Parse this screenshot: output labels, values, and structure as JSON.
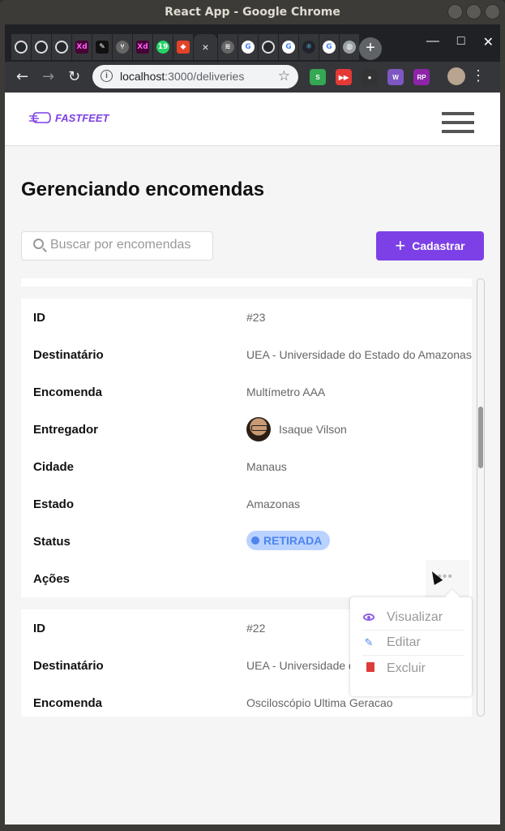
{
  "window": {
    "title": "React App - Google Chrome"
  },
  "browser": {
    "tabs": [
      {
        "icon": "github-icon",
        "glyph": ""
      },
      {
        "icon": "github-icon",
        "glyph": ""
      },
      {
        "icon": "github-icon",
        "glyph": ""
      },
      {
        "icon": "adobe-xd-icon",
        "glyph": "Xd"
      },
      {
        "icon": "pen-tool-icon",
        "glyph": "✎"
      },
      {
        "icon": "git-branch-icon",
        "glyph": "⑂"
      },
      {
        "icon": "adobe-xd-icon",
        "glyph": "Xd"
      },
      {
        "icon": "whatsapp-icon",
        "glyph": "19"
      },
      {
        "icon": "gitlab-icon",
        "glyph": "◆"
      },
      {
        "icon": "react-tab-close",
        "glyph": "×"
      },
      {
        "icon": "sdk-icon",
        "glyph": "≋"
      },
      {
        "icon": "google-icon",
        "glyph": "G"
      },
      {
        "icon": "github-icon",
        "glyph": ""
      },
      {
        "icon": "google-icon",
        "glyph": "G"
      },
      {
        "icon": "react-icon",
        "glyph": "⚛"
      },
      {
        "icon": "google-icon",
        "glyph": "G"
      },
      {
        "icon": "globe-icon",
        "glyph": "◍"
      }
    ],
    "url_host": "localhost",
    "url_path": ":3000/deliveries",
    "extensions": [
      {
        "glyph": "S",
        "color": "#34a853"
      },
      {
        "glyph": "▶▶",
        "color": "#e53935"
      },
      {
        "glyph": "●",
        "color": "#333333"
      },
      {
        "glyph": "W",
        "color": "#7e57c2"
      },
      {
        "glyph": "RP",
        "color": "#8e24aa"
      }
    ]
  },
  "app": {
    "logo_text": "FASTFEET",
    "page_title": "Gerenciando encomendas",
    "search_placeholder": "Buscar por encomendas",
    "add_button_label": "Cadastrar",
    "accent_color": "#7d40e7"
  },
  "deliveries": [
    {
      "fields": {
        "id_label": "ID",
        "id": "#23",
        "recipient_label": "Destinatário",
        "recipient": "UEA - Universidade do Estado do Amazonas",
        "product_label": "Encomenda",
        "product": "Multímetro AAA",
        "courier_label": "Entregador",
        "courier": "Isaque Vilson",
        "city_label": "Cidade",
        "city": "Manaus",
        "state_label": "Estado",
        "state": "Amazonas",
        "status_label": "Status",
        "status": "RETIRADA",
        "actions_label": "Ações",
        "actions_glyph": "•••"
      }
    },
    {
      "fields": {
        "id_label": "ID",
        "id": "#22",
        "recipient_label": "Destinatário",
        "recipient": "UEA - Universidade do Estado do Amazonas",
        "product_label": "Encomenda",
        "product": "Osciloscópio Ultima Geracao"
      }
    }
  ],
  "actions_menu": {
    "view": "Visualizar",
    "edit": "Editar",
    "delete": "Excluir"
  }
}
